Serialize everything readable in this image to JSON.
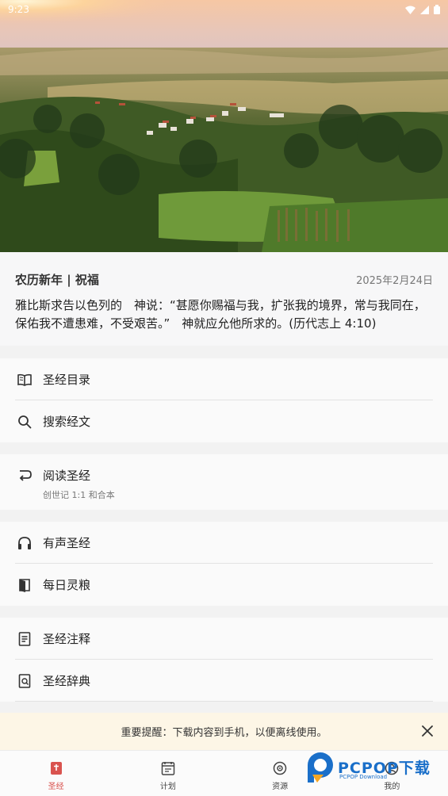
{
  "status_bar": {
    "time": "9:23"
  },
  "daily_verse": {
    "title": "农历新年 | 祝福",
    "date": "2025年2月24日",
    "text": "雅比斯求告以色列的　神说：“甚愿你赐福与我，扩张我的境界，常与我同在，保佑我不遭患难，不受艰苦。”　神就应允他所求的。(历代志上 4:10)"
  },
  "menu": {
    "group1": [
      {
        "label": "圣经目录",
        "icon": "book-open-icon"
      },
      {
        "label": "搜索经文",
        "icon": "search-icon"
      }
    ],
    "reading": {
      "label": "阅读圣经",
      "sub": "创世记 1:1 和合本",
      "icon": "return-arrow-icon"
    },
    "group3": [
      {
        "label": "有声圣经",
        "icon": "headphones-icon"
      },
      {
        "label": "每日灵粮",
        "icon": "door-book-icon"
      }
    ],
    "group4": [
      {
        "label": "圣经注释",
        "icon": "document-icon"
      },
      {
        "label": "圣经辞典",
        "icon": "dictionary-search-icon"
      }
    ]
  },
  "notice": {
    "text": "重要提醒：下载内容到手机，以便离线使用。"
  },
  "bottom_nav": {
    "bible": "圣经",
    "plan": "计划",
    "resources": "资源",
    "mine": "我的"
  },
  "watermark": {
    "brand": "PCPOP下载",
    "small": "PCPOP Download"
  },
  "colors": {
    "accent": "#d9534f",
    "notice_bg": "#fdf6e6"
  }
}
